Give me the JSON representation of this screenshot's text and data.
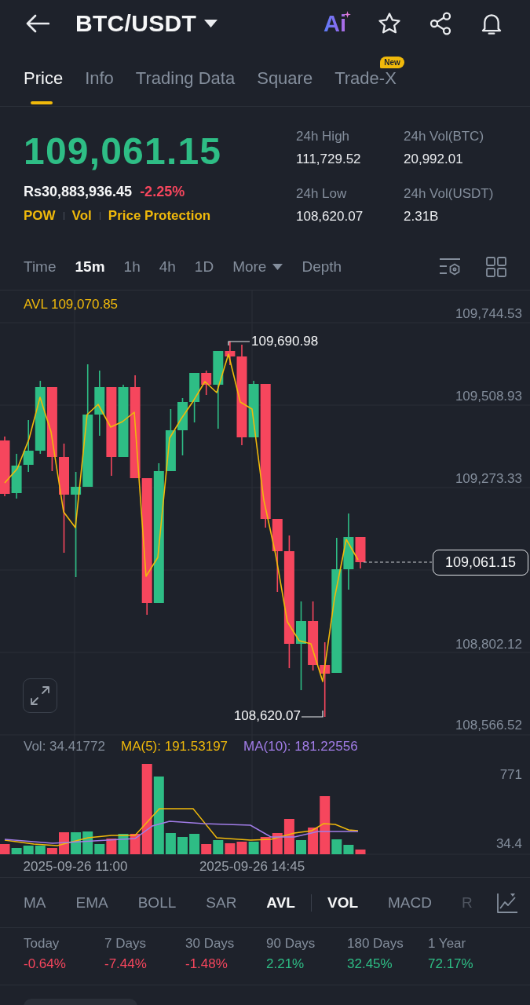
{
  "header": {
    "title": "BTC/USDT",
    "ai_label": "Ai"
  },
  "tabs": [
    {
      "label": "Price",
      "selected": true
    },
    {
      "label": "Info",
      "selected": false
    },
    {
      "label": "Trading Data",
      "selected": false
    },
    {
      "label": "Square",
      "selected": false
    },
    {
      "label": "Trade-X",
      "selected": false,
      "badge": "New"
    }
  ],
  "ticker": {
    "price": {
      "text": "109,061.15",
      "color": "#2ebd85"
    },
    "fiat_price": "Rs30,883,936.45",
    "change": {
      "text": "-2.25%",
      "color": "#f6465d"
    },
    "tags": [
      "POW",
      "Vol",
      "Price Protection"
    ],
    "stats": [
      {
        "label": "24h High",
        "value": "111,729.52"
      },
      {
        "label": "24h Vol(BTC)",
        "value": "20,992.01"
      },
      {
        "label": "24h Low",
        "value": "108,620.07"
      },
      {
        "label": "24h Vol(USDT)",
        "value": "2.31B"
      }
    ]
  },
  "intervals": [
    {
      "label": "Time",
      "kind": "option",
      "selected": false
    },
    {
      "label": "15m",
      "kind": "option",
      "selected": true
    },
    {
      "label": "1h",
      "kind": "option",
      "selected": false
    },
    {
      "label": "4h",
      "kind": "option",
      "selected": false
    },
    {
      "label": "1D",
      "kind": "option",
      "selected": false
    },
    {
      "label": "More",
      "kind": "dropdown",
      "selected": false
    },
    {
      "label": "Depth",
      "kind": "option",
      "selected": false
    }
  ],
  "price_chart": {
    "avl_label": "AVL 109,070.85",
    "y_axis_labels": [
      "109,744.53",
      "109,508.93",
      "109,273.33",
      "108,802.12",
      "108,566.52"
    ],
    "high_marker": "109,690.98",
    "low_marker": "108,620.07",
    "current_price": "109,061.15"
  },
  "volume_chart": {
    "vol_label": "Vol: 34.41772",
    "ma5_label": "MA(5): 191.53197",
    "ma10_label": "MA(10): 181.22556",
    "y_axis_labels": [
      "771",
      "34.4"
    ],
    "time_labels": [
      "2025-09-26 11:00",
      "2025-09-26 14:45"
    ]
  },
  "indicators": {
    "main": [
      {
        "label": "MA",
        "selected": false
      },
      {
        "label": "EMA",
        "selected": false
      },
      {
        "label": "BOLL",
        "selected": false
      },
      {
        "label": "SAR",
        "selected": false
      },
      {
        "label": "AVL",
        "selected": true
      }
    ],
    "sub": [
      {
        "label": "VOL",
        "selected": true
      },
      {
        "label": "MACD",
        "selected": false
      },
      {
        "label": "R",
        "selected": false
      }
    ]
  },
  "performance": [
    {
      "label": "Today",
      "value": "-0.64%",
      "color": "#f6465d"
    },
    {
      "label": "7 Days",
      "value": "-7.44%",
      "color": "#f6465d"
    },
    {
      "label": "30 Days",
      "value": "-1.48%",
      "color": "#f6465d"
    },
    {
      "label": "90 Days",
      "value": "2.21%",
      "color": "#2ebd85"
    },
    {
      "label": "180 Days",
      "value": "32.45%",
      "color": "#2ebd85"
    },
    {
      "label": "1 Year",
      "value": "72.17%",
      "color": "#2ebd85"
    }
  ]
}
